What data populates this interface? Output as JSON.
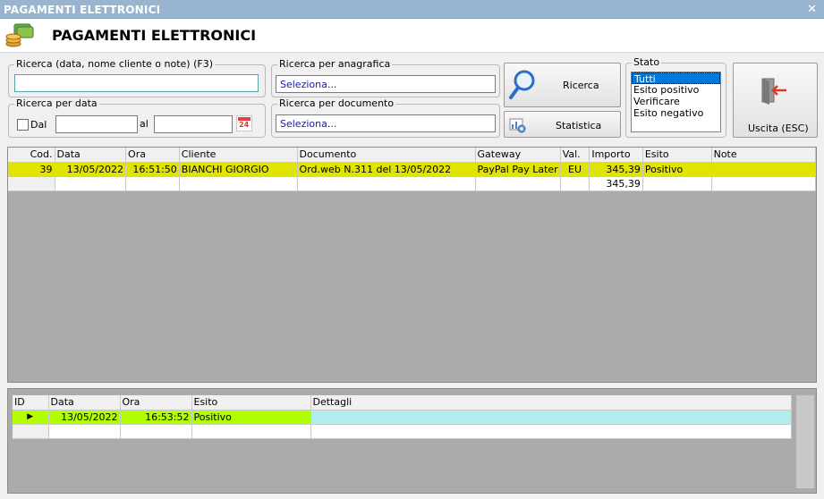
{
  "window": {
    "title": "PAGAMENTI ELETTRONICI",
    "close_glyph": "✕"
  },
  "header": {
    "title": "PAGAMENTI ELETTRONICI",
    "logo_icon": "coins-stack-icon"
  },
  "search": {
    "general_legend": "Ricerca (data, nome cliente o note) (F3)",
    "general_value": "",
    "anagrafica_legend": "Ricerca per anagrafica",
    "anagrafica_value": "Seleziona...",
    "documento_legend": "Ricerca per documento",
    "documento_value": "Seleziona...",
    "data_legend": "Ricerca per data",
    "dal_label": "Dal",
    "al_label": "al",
    "dal_value": "",
    "al_value": "",
    "calendar_icon": "calendar-icon",
    "calendar_day": "24"
  },
  "buttons": {
    "ricerca": "Ricerca",
    "statistica": "Statistica",
    "uscita": "Uscita (ESC)"
  },
  "stato": {
    "legend": "Stato",
    "options": [
      "Tutti",
      "Esito positivo",
      "Verificare",
      "Esito negativo"
    ],
    "selected_index": 0
  },
  "payments": {
    "columns": [
      "Cod.",
      "Data",
      "Ora",
      "Cliente",
      "Documento",
      "Gateway",
      "Val.",
      "Importo",
      "Esito",
      "Note"
    ],
    "rows": [
      {
        "cod": "39",
        "data": "13/05/2022",
        "ora": "16:51:50",
        "cliente": "BIANCHI GIORGIO",
        "documento": "Ord.web N.311 del 13/05/2022",
        "gateway": "PayPal Pay Later",
        "val": "EU",
        "importo": "345,39",
        "esito": "Positivo",
        "note": ""
      }
    ],
    "total_importo": "345,39"
  },
  "details": {
    "columns": [
      "ID",
      "Data",
      "Ora",
      "Esito",
      "Dettagli"
    ],
    "rows": [
      {
        "id": "",
        "data": "13/05/2022",
        "ora": "16:53:52",
        "esito": "Positivo",
        "dettagli": ""
      }
    ],
    "current_row_marker": "▶"
  },
  "colors": {
    "selected_row": "#e1e400",
    "detail_row": "#b2ff00",
    "detail_cell": "#aeeeec",
    "grid_bg": "#ababab",
    "titlebar": "#98b4cf"
  }
}
